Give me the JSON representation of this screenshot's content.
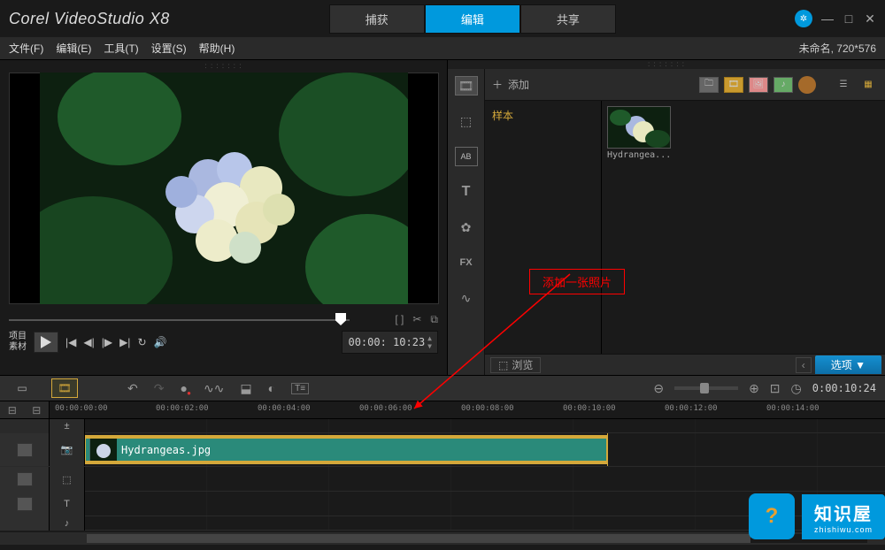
{
  "app": {
    "title": "Corel VideoStudio X8"
  },
  "main_tabs": [
    "捕获",
    "编辑",
    "共享"
  ],
  "main_tab_active": 1,
  "menu": {
    "file": "文件(F)",
    "edit": "编辑(E)",
    "tool": "工具(T)",
    "setting": "设置(S)",
    "help": "帮助(H)"
  },
  "project_info": "未命名, 720*576",
  "preview": {
    "labels": {
      "project": "项目",
      "clip": "素材"
    },
    "timecode": "00:00: 10:23",
    "dropdown_glyph": "▾"
  },
  "library": {
    "add_label": "添加",
    "folder": "样本",
    "thumb_label": "Hydrangea...",
    "browse_label": "浏览",
    "options_label": "选项",
    "scroll_glyph": "‹"
  },
  "annotation": {
    "text": "添加一张照片"
  },
  "timeline": {
    "total_timecode": "0:00:10:24",
    "ruler": [
      "00:00:00:00",
      "00:00:02:00",
      "00:00:04:00",
      "00:00:06:00",
      "00:00:08:00",
      "00:00:10:00",
      "00:00:12:00",
      "00:00:14:00"
    ],
    "clip_name": "Hydrangeas.jpg"
  },
  "watermark": {
    "brand": "知识屋",
    "domain": "zhishiwu.com"
  }
}
